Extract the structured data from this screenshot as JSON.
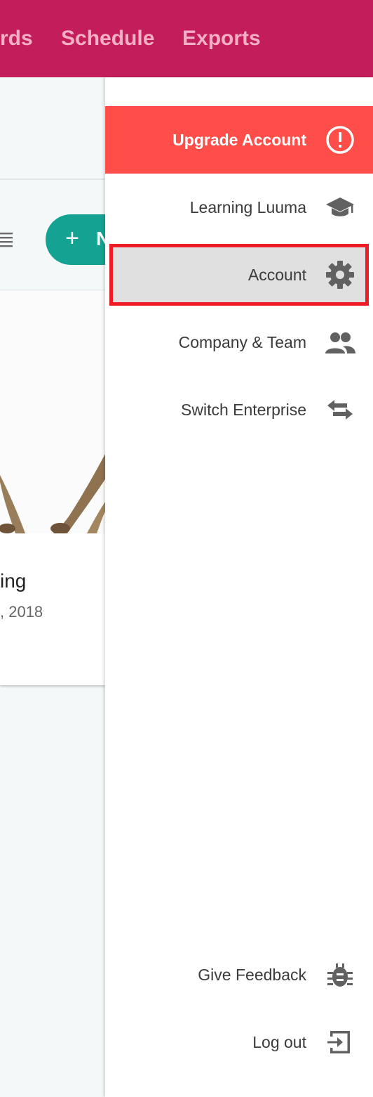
{
  "topbar": {
    "nav_items": [
      "rds",
      "Schedule",
      "Exports"
    ],
    "background": "#c41d5b"
  },
  "background_app": {
    "new_button_label": "N",
    "card": {
      "title": "ing",
      "date": ", 2018"
    }
  },
  "drawer": {
    "items": [
      {
        "label": "Upgrade Account",
        "icon": "exclamation-circle-icon"
      },
      {
        "label": "Learning Luuma",
        "icon": "graduation-cap-icon"
      },
      {
        "label": "Account",
        "icon": "gear-icon"
      },
      {
        "label": "Company & Team",
        "icon": "people-icon"
      },
      {
        "label": "Switch Enterprise",
        "icon": "switch-arrows-icon"
      }
    ],
    "footer_items": [
      {
        "label": "Give Feedback",
        "icon": "bug-icon"
      },
      {
        "label": "Log out",
        "icon": "logout-icon"
      }
    ]
  },
  "colors": {
    "upgrade_bg": "#ff4d4a",
    "highlight_border": "#ee1c24",
    "new_button": "#14a393"
  }
}
